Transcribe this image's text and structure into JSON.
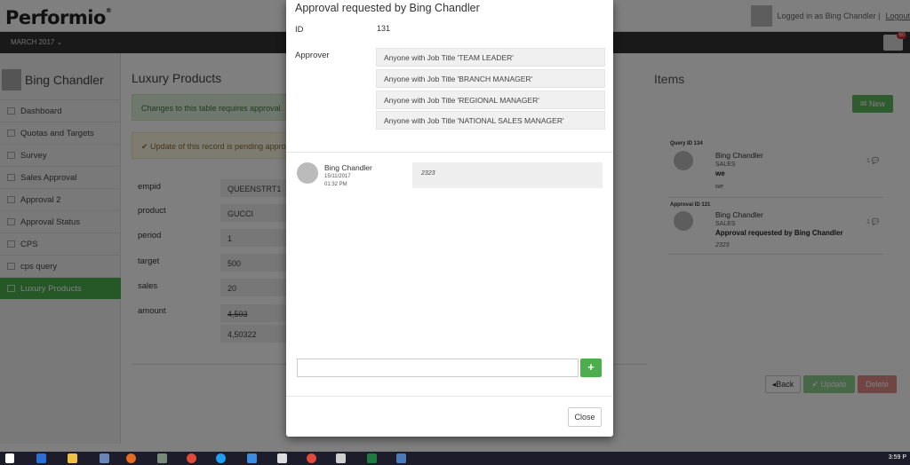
{
  "app": {
    "logo": "Performio",
    "logo_mark": "®"
  },
  "header": {
    "logged_in_text": "Logged in as Bing Chandler |",
    "logout": "Logout"
  },
  "nav": {
    "period": "MARCH 2017 ⌄",
    "mail_count": "60"
  },
  "sidebar": {
    "user_name": "Bing Chandler",
    "items": [
      {
        "label": "Dashboard"
      },
      {
        "label": "Quotas and Targets"
      },
      {
        "label": "Survey"
      },
      {
        "label": "Sales Approval"
      },
      {
        "label": "Approval 2"
      },
      {
        "label": "Approval Status"
      },
      {
        "label": "CPS"
      },
      {
        "label": "cps query"
      },
      {
        "label": "Luxury Products",
        "active": true
      }
    ]
  },
  "main": {
    "title": "Luxury Products",
    "alert_info": "Changes to this table requires approval.",
    "alert_pending": "✔ Update of this record is pending approval",
    "fields": [
      {
        "label": "empid",
        "value": "QUEENSTRT1"
      },
      {
        "label": "product",
        "value": "GUCCI"
      },
      {
        "label": "period",
        "value": "1"
      },
      {
        "label": "target",
        "value": "500"
      },
      {
        "label": "sales",
        "value": "20"
      },
      {
        "label": "amount",
        "value": "4,503",
        "new_value": "4,50322"
      }
    ],
    "buttons": {
      "back": "◂Back",
      "update": "✔ Update",
      "delete": "Delete"
    }
  },
  "items_panel": {
    "title": "Items",
    "new_button": "✉ New",
    "entries": [
      {
        "header": "Query ID 134",
        "name": "Bing Chandler",
        "dept": "SALES",
        "subject": "we",
        "body": "we",
        "count": "1"
      },
      {
        "header": "Approval ID 131",
        "name": "Bing Chandler",
        "dept": "SALES",
        "subject": "Approval requested by Bing Chandler",
        "body": "2323",
        "count": "1"
      }
    ]
  },
  "modal": {
    "title": "Approval requested by Bing Chandler",
    "id_label": "ID",
    "id_value": "131",
    "approver_label": "Approver",
    "approvers": [
      "Anyone with Job Title 'TEAM LEADER'",
      "Anyone with Job Title 'BRANCH MANAGER'",
      "Anyone with Job Title 'REGIONAL MANAGER'",
      "Anyone with Job Title 'NATIONAL SALES MANAGER'"
    ],
    "comment": {
      "author": "Bing Chandler",
      "date": "15/11/2017",
      "time": "01:32 PM",
      "text": "2323"
    },
    "comment_input": {
      "value": "",
      "placeholder": ""
    },
    "add_button": "+",
    "close_button": "Close"
  },
  "taskbar": {
    "time": "3:59 P",
    "icons": [
      "windows-start-icon",
      "outlook-icon",
      "file-explorer-icon",
      "app-icon",
      "firefox-icon",
      "app-icon",
      "chrome-icon",
      "skype-icon",
      "app-icon",
      "app-icon",
      "chrome-icon",
      "notepad-icon",
      "excel-icon",
      "app-icon"
    ]
  },
  "colors": {
    "accent_green": "#4cae4c",
    "nav_dark": "#333333",
    "danger": "#d9534f"
  }
}
